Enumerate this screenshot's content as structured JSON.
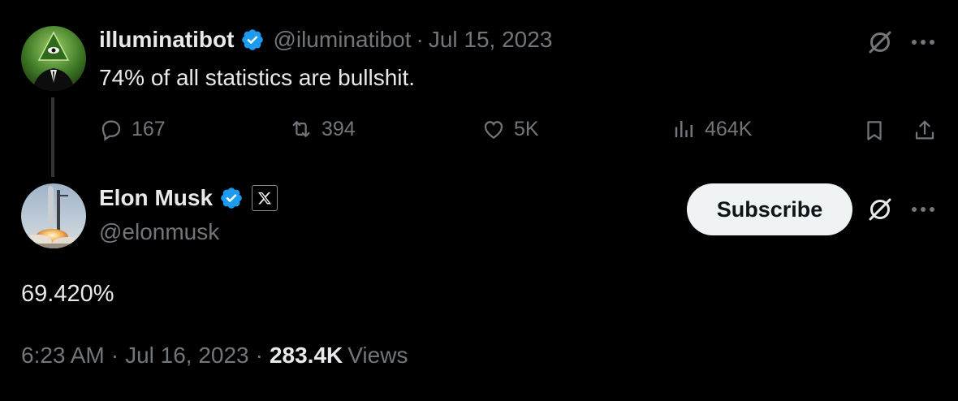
{
  "original_tweet": {
    "display_name": "illuminatibot",
    "handle": "@iluminatibot",
    "separator": "·",
    "date": "Jul 15, 2023",
    "text": "74% of all statistics are bullshit.",
    "actions": {
      "replies": "167",
      "reposts": "394",
      "likes": "5K",
      "views": "464K"
    }
  },
  "reply_tweet": {
    "display_name": "Elon Musk",
    "handle": "@elonmusk",
    "subscribe_label": "Subscribe",
    "text": "69.420%",
    "time": "6:23 AM",
    "dot1": "·",
    "date": "Jul 16, 2023",
    "dot2": "·",
    "views_count": "283.4K",
    "views_label": "Views"
  },
  "icons": {
    "verified": "verified-badge-icon",
    "grok": "grok-icon",
    "more": "more-icon",
    "reply": "reply-icon",
    "repost": "repost-icon",
    "like": "like-icon",
    "views": "views-icon",
    "bookmark": "bookmark-icon",
    "share": "share-icon",
    "x_affiliate": "x-logo-icon"
  },
  "colors": {
    "background": "#000000",
    "text": "#e7e9ea",
    "muted": "#71767b",
    "verified": "#1d9bf0",
    "subscribe_bg": "#eff3f4"
  }
}
